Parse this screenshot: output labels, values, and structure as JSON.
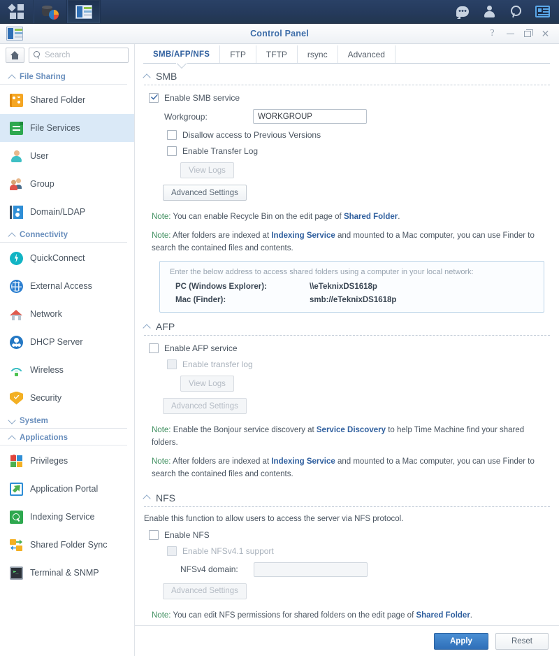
{
  "taskbar": {
    "left_icons": [
      {
        "name": "main-menu-icon",
        "label": "Main Menu"
      },
      {
        "name": "package-center-icon",
        "label": "Package Center"
      },
      {
        "name": "control-panel-icon",
        "label": "Control Panel"
      }
    ],
    "right_icons": [
      {
        "name": "notifications-chat-icon",
        "label": "Notifications"
      },
      {
        "name": "user-options-icon",
        "label": "Options"
      },
      {
        "name": "search-icon",
        "label": "Search"
      },
      {
        "name": "widgets-icon",
        "label": "Widgets"
      }
    ]
  },
  "window": {
    "title": "Control Panel",
    "controls": {
      "help": "?",
      "minimize": "–",
      "maximize": "❐",
      "close": "✕"
    }
  },
  "sidebar": {
    "home_label": "Home",
    "search_placeholder": "Search",
    "search_value": "",
    "groups": [
      {
        "label": "File Sharing",
        "expanded": true,
        "items": [
          {
            "label": "Shared Folder",
            "icon": "shared-folder-icon",
            "active": false
          },
          {
            "label": "File Services",
            "icon": "file-services-icon",
            "active": true
          },
          {
            "label": "User",
            "icon": "user-icon",
            "active": false
          },
          {
            "label": "Group",
            "icon": "group-icon",
            "active": false
          },
          {
            "label": "Domain/LDAP",
            "icon": "domain-ldap-icon",
            "active": false
          }
        ]
      },
      {
        "label": "Connectivity",
        "expanded": true,
        "items": [
          {
            "label": "QuickConnect",
            "icon": "quickconnect-icon",
            "active": false
          },
          {
            "label": "External Access",
            "icon": "external-access-icon",
            "active": false
          },
          {
            "label": "Network",
            "icon": "network-icon",
            "active": false
          },
          {
            "label": "DHCP Server",
            "icon": "dhcp-server-icon",
            "active": false
          },
          {
            "label": "Wireless",
            "icon": "wireless-icon",
            "active": false
          },
          {
            "label": "Security",
            "icon": "security-icon",
            "active": false
          }
        ]
      },
      {
        "label": "System",
        "expanded": false,
        "items": []
      },
      {
        "label": "Applications",
        "expanded": true,
        "items": [
          {
            "label": "Privileges",
            "icon": "privileges-icon",
            "active": false
          },
          {
            "label": "Application Portal",
            "icon": "application-portal-icon",
            "active": false
          },
          {
            "label": "Indexing Service",
            "icon": "indexing-service-icon",
            "active": false
          },
          {
            "label": "Shared Folder Sync",
            "icon": "shared-folder-sync-icon",
            "active": false
          },
          {
            "label": "Terminal & SNMP",
            "icon": "terminal-snmp-icon",
            "active": false
          }
        ]
      }
    ]
  },
  "tabs": [
    {
      "label": "SMB/AFP/NFS",
      "active": true
    },
    {
      "label": "FTP",
      "active": false
    },
    {
      "label": "TFTP",
      "active": false
    },
    {
      "label": "rsync",
      "active": false
    },
    {
      "label": "Advanced",
      "active": false
    }
  ],
  "smb": {
    "section_title": "SMB",
    "enable_label": "Enable SMB service",
    "enable_checked": true,
    "workgroup_label": "Workgroup:",
    "workgroup_value": "WORKGROUP",
    "disallow_label": "Disallow access to Previous Versions",
    "disallow_checked": false,
    "transferlog_label": "Enable Transfer Log",
    "transferlog_checked": false,
    "viewlogs_label": "View Logs",
    "advanced_label": "Advanced Settings",
    "note1_prefix": "Note:",
    "note1_a": " You can enable Recycle Bin on the edit page of ",
    "note1_link": "Shared Folder",
    "note1_b": ".",
    "note2_prefix": "Note:",
    "note2_a": " After folders are indexed at ",
    "note2_link": "Indexing Service",
    "note2_b": " and mounted to a Mac computer, you can use Finder to search the contained files and contents.",
    "address_intro": "Enter the below address to access shared folders using a computer in your local network:",
    "address_rows": [
      {
        "key": "PC (Windows Explorer):",
        "value": "\\\\eTeknixDS1618p"
      },
      {
        "key": "Mac (Finder):",
        "value": "smb://eTeknixDS1618p"
      }
    ]
  },
  "afp": {
    "section_title": "AFP",
    "enable_label": "Enable AFP service",
    "enable_checked": false,
    "transferlog_label": "Enable transfer log",
    "transferlog_checked": false,
    "viewlogs_label": "View Logs",
    "advanced_label": "Advanced Settings",
    "note1_prefix": "Note:",
    "note1_a": " Enable the Bonjour service discovery at ",
    "note1_link": "Service Discovery",
    "note1_b": " to help Time Machine find your shared folders.",
    "note2_prefix": "Note:",
    "note2_a": " After folders are indexed at ",
    "note2_link": "Indexing Service",
    "note2_b": " and mounted to a Mac computer, you can use Finder to search the contained files and contents."
  },
  "nfs": {
    "section_title": "NFS",
    "description": "Enable this function to allow users to access the server via NFS protocol.",
    "enable_label": "Enable NFS",
    "enable_checked": false,
    "nfsv41_label": "Enable NFSv4.1 support",
    "nfsv41_checked": false,
    "domain_label": "NFSv4 domain:",
    "domain_value": "",
    "advanced_label": "Advanced Settings",
    "note1_prefix": "Note:",
    "note1_a": " You can edit NFS permissions for shared folders on the edit page of ",
    "note1_link": "Shared Folder",
    "note1_b": "."
  },
  "footer": {
    "apply_label": "Apply",
    "reset_label": "Reset"
  },
  "colors": {
    "accent": "#2f5f9e",
    "primary_button": "#2f6fb8",
    "active_sidebar": "#dae9f7",
    "note_label": "#3f8f5f",
    "desktop": "#24405f"
  }
}
